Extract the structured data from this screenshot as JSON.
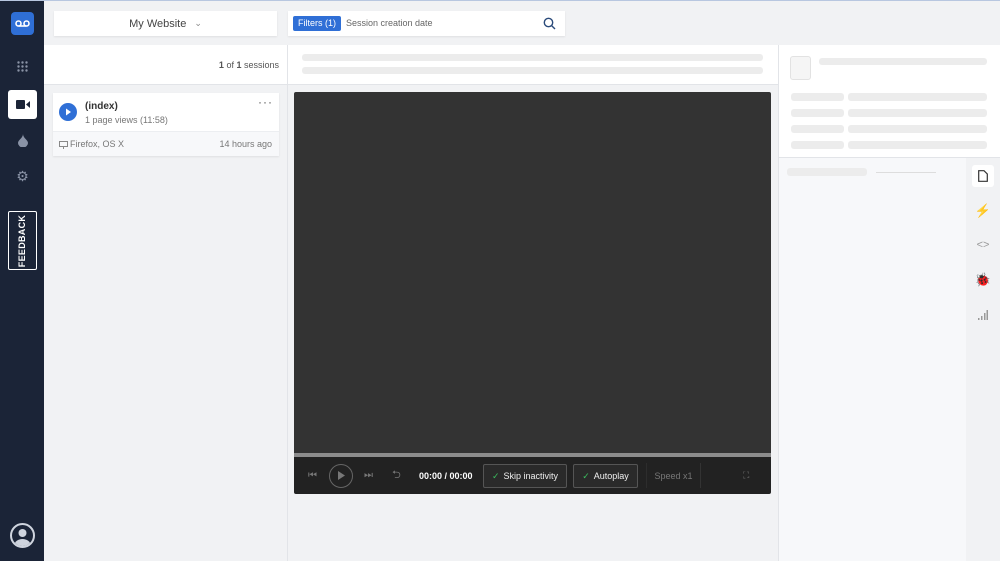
{
  "header": {
    "website": "My Website",
    "filters_label": "Filters (1)",
    "filter_text": "Session creation date"
  },
  "sessions": {
    "count_current": "1",
    "count_of": " of ",
    "count_total": "1",
    "count_suffix": " sessions",
    "items": [
      {
        "title": "(index)",
        "subtitle": "1 page views (11:58)",
        "browser": "Firefox, OS X",
        "time": "14 hours ago"
      }
    ]
  },
  "sidebar": {
    "feedback": "FEEDBACK"
  },
  "player": {
    "time": "00:00 / 00:00",
    "skip_inactivity": "Skip inactivity",
    "autoplay": "Autoplay",
    "speed": "Speed x1",
    "progress": 0
  },
  "colors": {
    "accent": "#2f6fd6",
    "sidebar": "#1b2437",
    "player": "#333333"
  }
}
